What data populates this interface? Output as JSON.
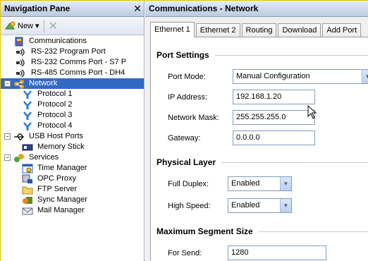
{
  "nav": {
    "title": "Navigation Pane",
    "close_glyph": "✕",
    "toolbar": {
      "new_label": "New ▾"
    },
    "tree": [
      {
        "label": "Communications",
        "level": 0,
        "icon": "communications-icon",
        "expand": ""
      },
      {
        "label": "RS-232 Program Port",
        "level": 1,
        "icon": "port-icon"
      },
      {
        "label": "RS-232 Comms Port - S7 P",
        "level": 1,
        "icon": "port-icon"
      },
      {
        "label": "RS-485 Comms Port - DH4",
        "level": 1,
        "icon": "port-icon"
      },
      {
        "label": "Network",
        "level": 0,
        "icon": "network-icon",
        "expand": "−",
        "selected": true
      },
      {
        "label": "Protocol 1",
        "level": 2,
        "icon": "protocol-icon"
      },
      {
        "label": "Protocol 2",
        "level": 2,
        "icon": "protocol-icon"
      },
      {
        "label": "Protocol 3",
        "level": 2,
        "icon": "protocol-icon"
      },
      {
        "label": "Protocol 4",
        "level": 2,
        "icon": "protocol-icon"
      },
      {
        "label": "USB Host Ports",
        "level": 0,
        "icon": "usb-icon",
        "expand": "−"
      },
      {
        "label": "Memory Stick",
        "level": 2,
        "icon": "memory-stick-icon"
      },
      {
        "label": "Services",
        "level": 0,
        "icon": "services-icon",
        "expand": "−"
      },
      {
        "label": "Time Manager",
        "level": 2,
        "icon": "time-manager-icon"
      },
      {
        "label": "OPC Proxy",
        "level": 2,
        "icon": "opc-proxy-icon"
      },
      {
        "label": "FTP Server",
        "level": 2,
        "icon": "ftp-server-icon"
      },
      {
        "label": "Sync Manager",
        "level": 2,
        "icon": "sync-manager-icon"
      },
      {
        "label": "Mail Manager",
        "level": 2,
        "icon": "mail-manager-icon"
      }
    ]
  },
  "content": {
    "title": "Communications - Network",
    "tabs": [
      "Ethernet 1",
      "Ethernet 2",
      "Routing",
      "Download",
      "Add Port"
    ],
    "active_tab": "Ethernet 1",
    "port_settings": {
      "title": "Port Settings",
      "port_mode_label": "Port Mode:",
      "port_mode_value": "Manual Configuration",
      "ip_label": "IP Address:",
      "ip_value": "192.168.1.20",
      "mask_label": "Network Mask:",
      "mask_value": "255.255.255.0",
      "gateway_label": "Gateway:",
      "gateway_value": "0.0.0.0"
    },
    "physical_layer": {
      "title": "Physical Layer",
      "full_duplex_label": "Full Duplex:",
      "full_duplex_value": "Enabled",
      "high_speed_label": "High Speed:",
      "high_speed_value": "Enabled"
    },
    "segment_size": {
      "title": "Maximum Segment Size",
      "for_send_label": "For Send:",
      "for_send_value": "1280"
    }
  },
  "colors": {
    "selection": "#316ac5",
    "header_gradient_top": "#e4ecf7",
    "header_gradient_bottom": "#bccbe1",
    "frame_border": "#e7c400"
  }
}
